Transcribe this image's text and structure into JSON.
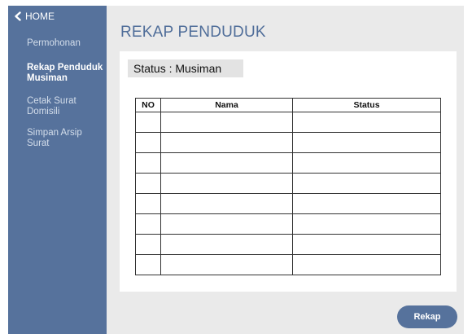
{
  "sidebar": {
    "home_label": "HOME",
    "items": [
      {
        "label": "Permohonan",
        "active": false
      },
      {
        "label": "Rekap Penduduk Musiman",
        "active": true
      },
      {
        "label": "Cetak Surat Domisili",
        "active": false
      },
      {
        "label": "Simpan Arsip Surat",
        "active": false
      }
    ]
  },
  "main": {
    "title": "REKAP PENDUDUK",
    "status_label": "Status : Musiman",
    "table": {
      "headers": [
        "NO",
        "Nama",
        "Status"
      ],
      "rows": [
        [
          "",
          "",
          ""
        ],
        [
          "",
          "",
          ""
        ],
        [
          "",
          "",
          ""
        ],
        [
          "",
          "",
          ""
        ],
        [
          "",
          "",
          ""
        ],
        [
          "",
          "",
          ""
        ],
        [
          "",
          "",
          ""
        ],
        [
          "",
          "",
          ""
        ]
      ]
    },
    "rekap_button": "Rekap"
  },
  "colors": {
    "sidebar_bg": "#56729c",
    "title": "#4f6d99",
    "background": "#eaeaea",
    "button_bg": "#56729c"
  },
  "icons": {
    "home": "chevron-left-icon"
  }
}
